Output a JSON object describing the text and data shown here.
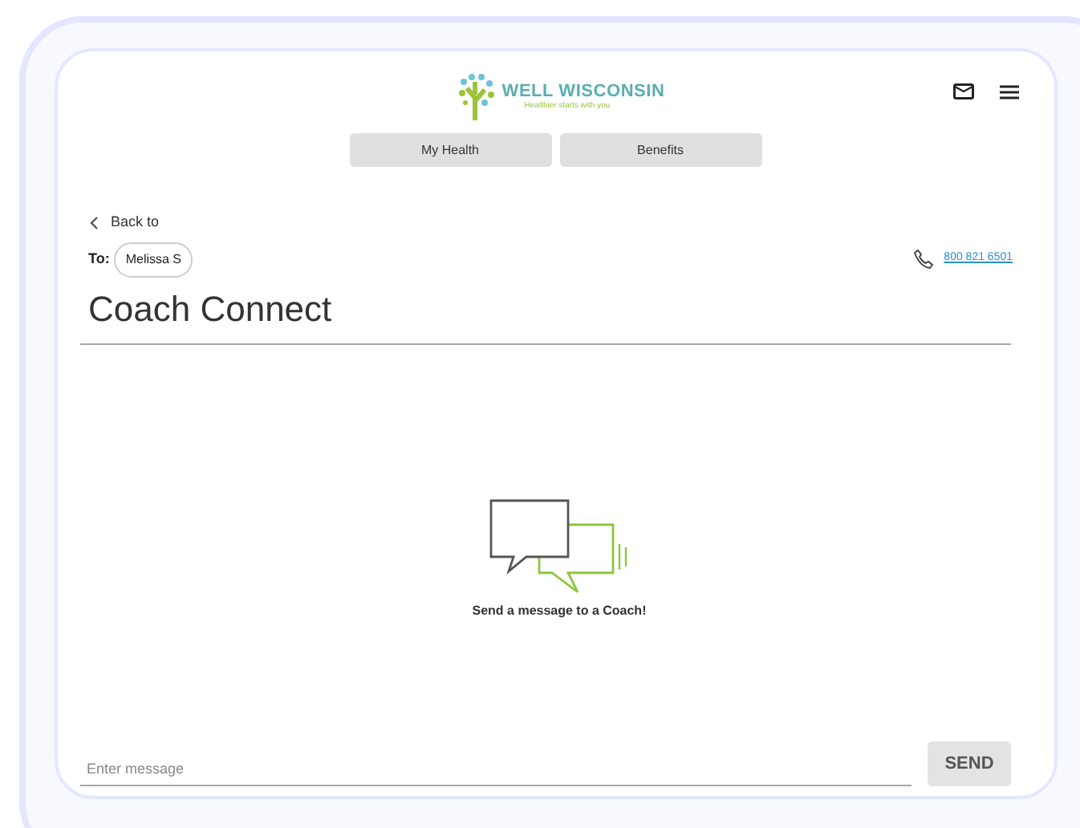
{
  "header": {
    "logo_title": "WELL WISCONSIN",
    "logo_tagline": "Healthier starts with you"
  },
  "tabs": [
    {
      "label": "My Health"
    },
    {
      "label": "Benefits"
    }
  ],
  "back_link": "Back to",
  "recipient": {
    "label": "To:",
    "name": "Melissa S"
  },
  "phone": "800 821 6501",
  "title": "Coach Connect",
  "empty_state": "Send a message to a Coach!",
  "composer": {
    "placeholder": "Enter message",
    "send": "SEND"
  }
}
